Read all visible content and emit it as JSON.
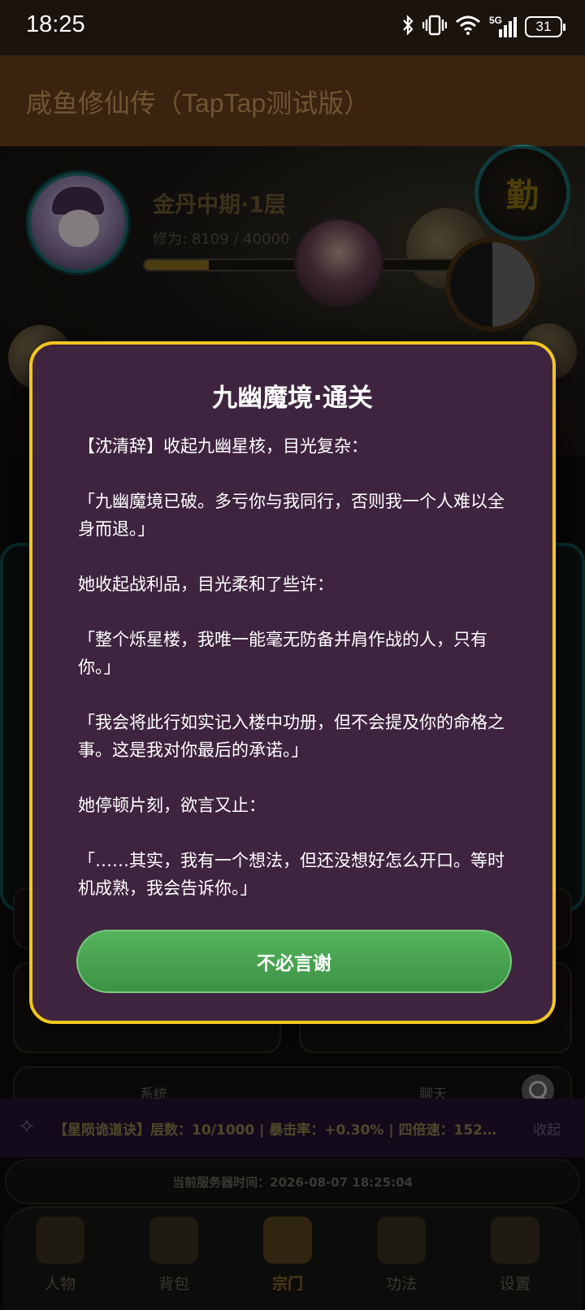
{
  "status_bar": {
    "time": "18:25",
    "network": "5G",
    "battery": "31",
    "icons": [
      "bluetooth-icon",
      "vibrate-icon",
      "wifi-icon",
      "signal-icon"
    ]
  },
  "app": {
    "title": "咸鱼修仙传（TapTap测试版）"
  },
  "player": {
    "realm": "金丹中期·1层",
    "cultivation_label": "修为:",
    "cultivation_value": "8109 / 40000",
    "cultivation_progress": 0.2027,
    "diligence_button": "勤"
  },
  "modal": {
    "title": "九幽魔境·通关",
    "paragraphs": [
      "【沈清辞】收起九幽星核，目光复杂：",
      "「九幽魔境已破。多亏你与我同行，否则我一个人难以全身而退。」",
      "她收起战利品，目光柔和了些许：",
      "「整个烁星楼，我唯一能毫无防备并肩作战的人，只有你。」",
      "「我会将此行如实记入楼中功册，但不会提及你的命格之事。这是我对你最后的承诺。」",
      "她停顿片刻，欲言又止：",
      "「……其实，我有一个想法，但还没想好怎么开口。等时机成熟，我会告诉你。」"
    ],
    "confirm_label": "不必言谢"
  },
  "chat": {
    "tabs": [
      "系统",
      "聊天"
    ]
  },
  "buff": {
    "text": "【星陨诡道诀】层数：10/1000 | 暴击率：+0.30% | 四倍速：152…",
    "collapse_label": "收起"
  },
  "server": {
    "time_label": "当前服务器时间：2026-08-07 18:25:04"
  },
  "nav": {
    "items": [
      {
        "label": "人物",
        "icon": "character-icon",
        "active": false
      },
      {
        "label": "背包",
        "icon": "bag-icon",
        "active": false
      },
      {
        "label": "宗门",
        "icon": "sect-icon",
        "active": true
      },
      {
        "label": "功法",
        "icon": "scroll-icon",
        "active": false
      },
      {
        "label": "设置",
        "icon": "gear-icon",
        "active": false
      }
    ]
  },
  "colors": {
    "modal_bg": "#3f2440",
    "modal_border": "#f1c71f",
    "confirm_button": "#4caf50"
  }
}
